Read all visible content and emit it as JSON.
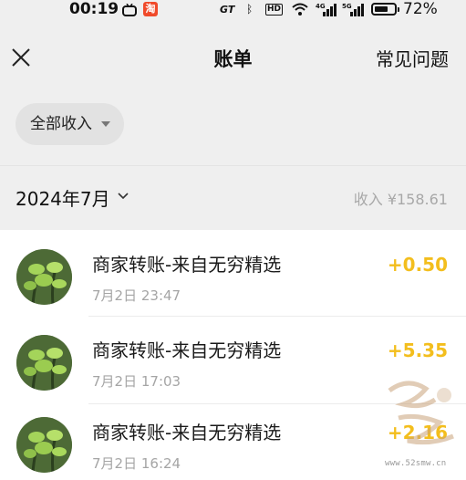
{
  "status_bar": {
    "time": "00:19",
    "app_badge": "淘",
    "network_label": "GT",
    "hd_label": "HD",
    "sig1_label": "4G",
    "sig2_label": "5G",
    "battery_percent": "72%",
    "battery_level": 0.72
  },
  "nav": {
    "title": "账单",
    "faq_label": "常见问题"
  },
  "filter": {
    "selected": "全部收入"
  },
  "month_row": {
    "month": "2024年7月",
    "income_summary": "收入 ¥158.61"
  },
  "transactions": [
    {
      "title": "商家转账-来自无穷精选",
      "time": "7月2日 23:47",
      "amount": "+0.50"
    },
    {
      "title": "商家转账-来自无穷精选",
      "time": "7月2日 17:03",
      "amount": "+5.35"
    },
    {
      "title": "商家转账-来自无穷精选",
      "time": "7月2日 16:24",
      "amount": "+2.16"
    }
  ],
  "watermark": {
    "url": "www.52smw.cn"
  },
  "colors": {
    "amount": "#f3be1d",
    "header_bg": "#efefef"
  }
}
